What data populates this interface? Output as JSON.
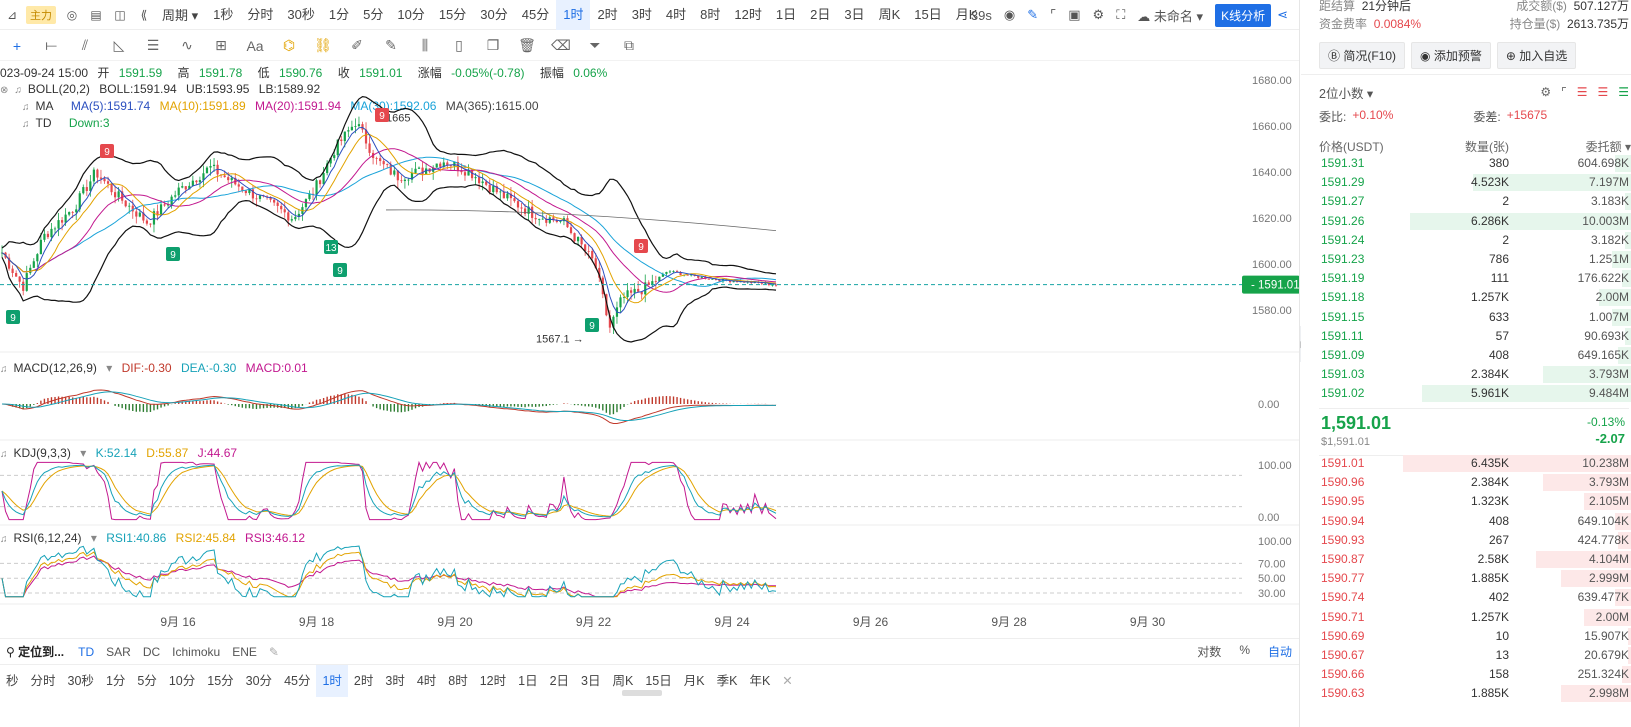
{
  "toolbar": {
    "main_badge": "主力",
    "period_label": "周期",
    "timeframes": [
      "1秒",
      "分时",
      "30秒",
      "1分",
      "5分",
      "10分",
      "15分",
      "30分",
      "45分",
      "1时",
      "2时",
      "3时",
      "4时",
      "8时",
      "12时",
      "1日",
      "2日",
      "3日",
      "周K",
      "15日",
      "月K"
    ],
    "active_timeframe_index": 9,
    "countdown": "39s",
    "template_name": "未命名",
    "kline_button": "K线分析"
  },
  "draw_tools": [
    "cross-icon",
    "horizontal-ray-icon",
    "trend-line-icon",
    "triangle-icon",
    "parallel-lines-icon",
    "wave-icon",
    "crosshair-box-icon",
    "text-icon",
    "magnet-icon",
    "link-icon",
    "ruler-icon",
    "pencil-icon",
    "candles-icon",
    "position-icon",
    "copy-icon",
    "trash-icon",
    "eraser-icon",
    "filter-icon",
    "settings-copy-icon"
  ],
  "text_tool_label": "Aa",
  "ohlc": {
    "date": "023-09-24 15:00",
    "open_label": "开",
    "open": "1591.59",
    "high_label": "高",
    "high": "1591.78",
    "low_label": "低",
    "low": "1590.76",
    "close_label": "收",
    "close": "1591.01",
    "change_label": "涨幅",
    "change": "-0.05%(-0.78)",
    "amp_label": "振幅",
    "amp": "0.06%"
  },
  "indicators": {
    "boll": {
      "name": "BOLL(20,2)",
      "boll": "BOLL:1591.94",
      "ub": "UB:1593.95",
      "lb": "LB:1589.92"
    },
    "ma": {
      "name": "MA",
      "ma5": "MA(5):1591.74",
      "ma10": "MA(10):1591.89",
      "ma20": "MA(20):1591.94",
      "ma30": "MA(30):1592.06",
      "ma365": "MA(365):1615.00"
    },
    "td": {
      "name": "TD",
      "value": "Down:3"
    },
    "macd": {
      "name": "MACD(12,26,9)",
      "dif": "DIF:-0.30",
      "dea": "DEA:-0.30",
      "macd": "MACD:0.01"
    },
    "kdj": {
      "name": "KDJ(9,3,3)",
      "k": "K:52.14",
      "d": "D:55.87",
      "j": "J:44.67"
    },
    "rsi": {
      "name": "RSI(6,12,24)",
      "r1": "RSI1:40.86",
      "r2": "RSI2:45.84",
      "r3": "RSI3:46.12"
    }
  },
  "price_axis": [
    "1680.00",
    "1660.00",
    "1640.00",
    "1620.00",
    "1600.00",
    "1580.00"
  ],
  "current_price_tag": "1591.01",
  "macd_axis": [
    "0.00"
  ],
  "kdj_axis": [
    "100.00",
    "0.00"
  ],
  "rsi_axis": [
    "100.00",
    "70.00",
    "50.00",
    "30.00"
  ],
  "date_axis": [
    "9月 16",
    "9月 18",
    "9月 20",
    "9月 22",
    "9月 24",
    "9月 26",
    "9月 28",
    "9月 30"
  ],
  "annotations": {
    "high_label": "1665",
    "low_label": "1567.1",
    "td_markers": [
      "9",
      "9",
      "9",
      "13",
      "9",
      "9",
      "9",
      "9"
    ]
  },
  "bottom_bar": {
    "locate": "定位到...",
    "items": [
      "TD",
      "SAR",
      "DC",
      "Ichimoku",
      "ENE"
    ],
    "right": [
      "对数",
      "%",
      "自动"
    ]
  },
  "bottom_timeframes": [
    "秒",
    "分时",
    "30秒",
    "1分",
    "5分",
    "10分",
    "15分",
    "30分",
    "45分",
    "1时",
    "2时",
    "3时",
    "4时",
    "8时",
    "12时",
    "1日",
    "2日",
    "3日",
    "周K",
    "15日",
    "月K",
    "季K",
    "年K"
  ],
  "bottom_active_index": 9,
  "orderbook": {
    "stats": [
      {
        "label": "距结算",
        "value": "21分钟后",
        "label2": "成交额($)",
        "value2": "507.127万"
      },
      {
        "label": "资金费率",
        "value": "0.0084%",
        "label2": "持仓量($)",
        "value2": "2613.735万"
      }
    ],
    "buttons": [
      "简况(F10)",
      "添加预警",
      "加入自选"
    ],
    "precision": "2位小数",
    "ratio_label": "委比:",
    "ratio": "+0.10%",
    "diff_label": "委差:",
    "diff": "+15675",
    "col_price": "价格(USDT)",
    "col_qty": "数量(张)",
    "col_total": "委托额",
    "bids": [
      {
        "p": "1591.31",
        "q": "380",
        "t": "604.698K",
        "w": 0.05
      },
      {
        "p": "1591.29",
        "q": "4.523K",
        "t": "7.197M",
        "w": 0.5
      },
      {
        "p": "1591.27",
        "q": "2",
        "t": "3.183K",
        "w": 0.02
      },
      {
        "p": "1591.26",
        "q": "6.286K",
        "t": "10.003M",
        "w": 0.7
      },
      {
        "p": "1591.24",
        "q": "2",
        "t": "3.182K",
        "w": 0.02
      },
      {
        "p": "1591.23",
        "q": "786",
        "t": "1.251M",
        "w": 0.06
      },
      {
        "p": "1591.19",
        "q": "111",
        "t": "176.622K",
        "w": 0.03
      },
      {
        "p": "1591.18",
        "q": "1.257K",
        "t": "2.00M",
        "w": 0.1
      },
      {
        "p": "1591.15",
        "q": "633",
        "t": "1.007M",
        "w": 0.06
      },
      {
        "p": "1591.11",
        "q": "57",
        "t": "90.693K",
        "w": 0.02
      },
      {
        "p": "1591.09",
        "q": "408",
        "t": "649.165K",
        "w": 0.04
      },
      {
        "p": "1591.03",
        "q": "2.384K",
        "t": "3.793M",
        "w": 0.28
      },
      {
        "p": "1591.02",
        "q": "5.961K",
        "t": "9.484M",
        "w": 0.66
      }
    ],
    "last_price": "1,591.01",
    "last_usd": "$1,591.01",
    "last_pct": "-0.13%",
    "last_chg": "-2.07",
    "asks": [
      {
        "p": "1591.01",
        "q": "6.435K",
        "t": "10.238M",
        "w": 0.72
      },
      {
        "p": "1590.96",
        "q": "2.384K",
        "t": "3.793M",
        "w": 0.28
      },
      {
        "p": "1590.95",
        "q": "1.323K",
        "t": "2.105M",
        "w": 0.15
      },
      {
        "p": "1590.94",
        "q": "408",
        "t": "649.104K",
        "w": 0.05
      },
      {
        "p": "1590.93",
        "q": "267",
        "t": "424.778K",
        "w": 0.04
      },
      {
        "p": "1590.87",
        "q": "2.58K",
        "t": "4.104M",
        "w": 0.3
      },
      {
        "p": "1590.77",
        "q": "1.885K",
        "t": "2.999M",
        "w": 0.22
      },
      {
        "p": "1590.74",
        "q": "402",
        "t": "639.477K",
        "w": 0.05
      },
      {
        "p": "1590.71",
        "q": "1.257K",
        "t": "2.00M",
        "w": 0.15
      },
      {
        "p": "1590.69",
        "q": "10",
        "t": "15.907K",
        "w": 0.01
      },
      {
        "p": "1590.67",
        "q": "13",
        "t": "20.679K",
        "w": 0.01
      },
      {
        "p": "1590.66",
        "q": "158",
        "t": "251.324K",
        "w": 0.03
      },
      {
        "p": "1590.63",
        "q": "1.885K",
        "t": "2.998M",
        "w": 0.22
      }
    ]
  },
  "colors": {
    "accent": "#1f6fe5",
    "up": "#16a34a",
    "down": "#e5484d"
  }
}
